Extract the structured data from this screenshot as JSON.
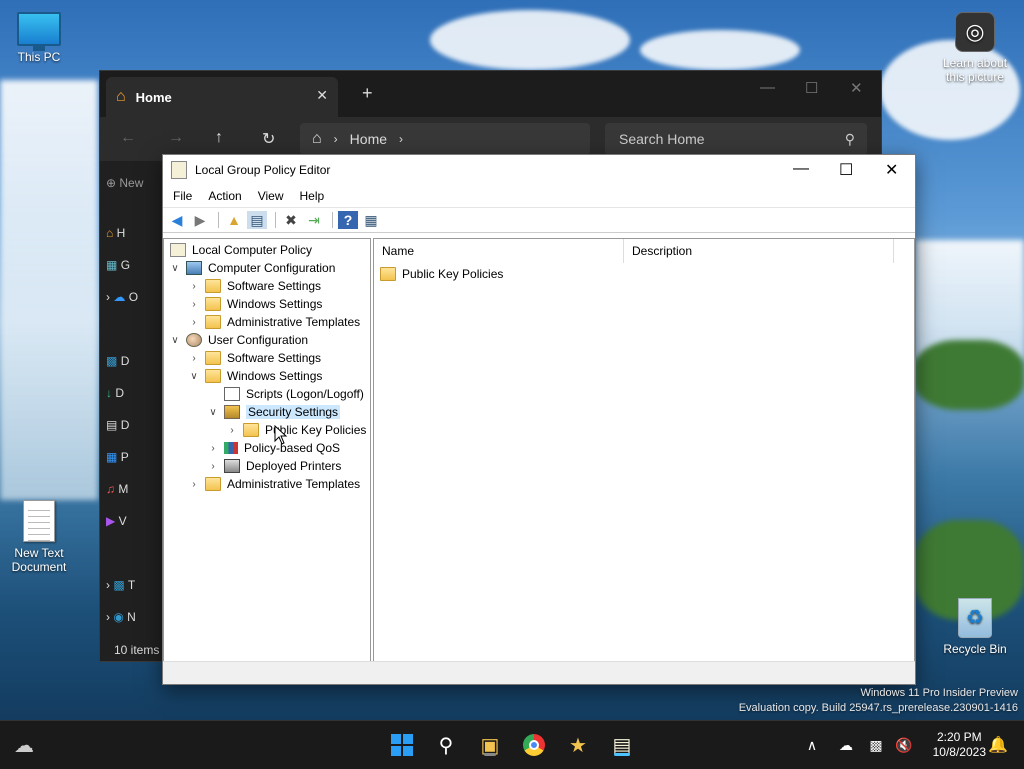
{
  "desktop": {
    "icons": [
      {
        "label": "This PC"
      },
      {
        "label": "Learn about this picture"
      },
      {
        "label": "New Text Document"
      },
      {
        "label": "Recycle Bin"
      }
    ],
    "watermark_line1": "Windows 11 Pro Insider Preview",
    "watermark_line2": "Evaluation copy. Build 25947.rs_prerelease.230901-1416"
  },
  "explorer": {
    "tab_title": "Home",
    "address": "Home",
    "search_placeholder": "Search Home",
    "new_label": "New",
    "sidebar_letters": [
      "H",
      "G",
      "O",
      "D",
      "D",
      "D",
      "P",
      "M",
      "V",
      "T",
      "N"
    ],
    "status": "10 items"
  },
  "gpe": {
    "title": "Local Group Policy Editor",
    "menu": [
      "File",
      "Action",
      "View",
      "Help"
    ],
    "tree": {
      "root": "Local Computer Policy",
      "computer_configuration": "Computer Configuration",
      "cc_software_settings": "Software Settings",
      "cc_windows_settings": "Windows Settings",
      "cc_admin_templates": "Administrative Templates",
      "user_configuration": "User Configuration",
      "uc_software_settings": "Software Settings",
      "uc_windows_settings": "Windows Settings",
      "scripts": "Scripts (Logon/Logoff)",
      "security_settings": "Security Settings",
      "public_key_policies": "Public Key Policies",
      "policy_qos": "Policy-based QoS",
      "deployed_printers": "Deployed Printers",
      "uc_admin_templates": "Administrative Templates"
    },
    "list": {
      "columns": [
        "Name",
        "Description"
      ],
      "rows": [
        {
          "name": "Public Key Policies",
          "description": ""
        }
      ]
    }
  },
  "taskbar": {
    "time": "2:20 PM",
    "date": "10/8/2023"
  }
}
